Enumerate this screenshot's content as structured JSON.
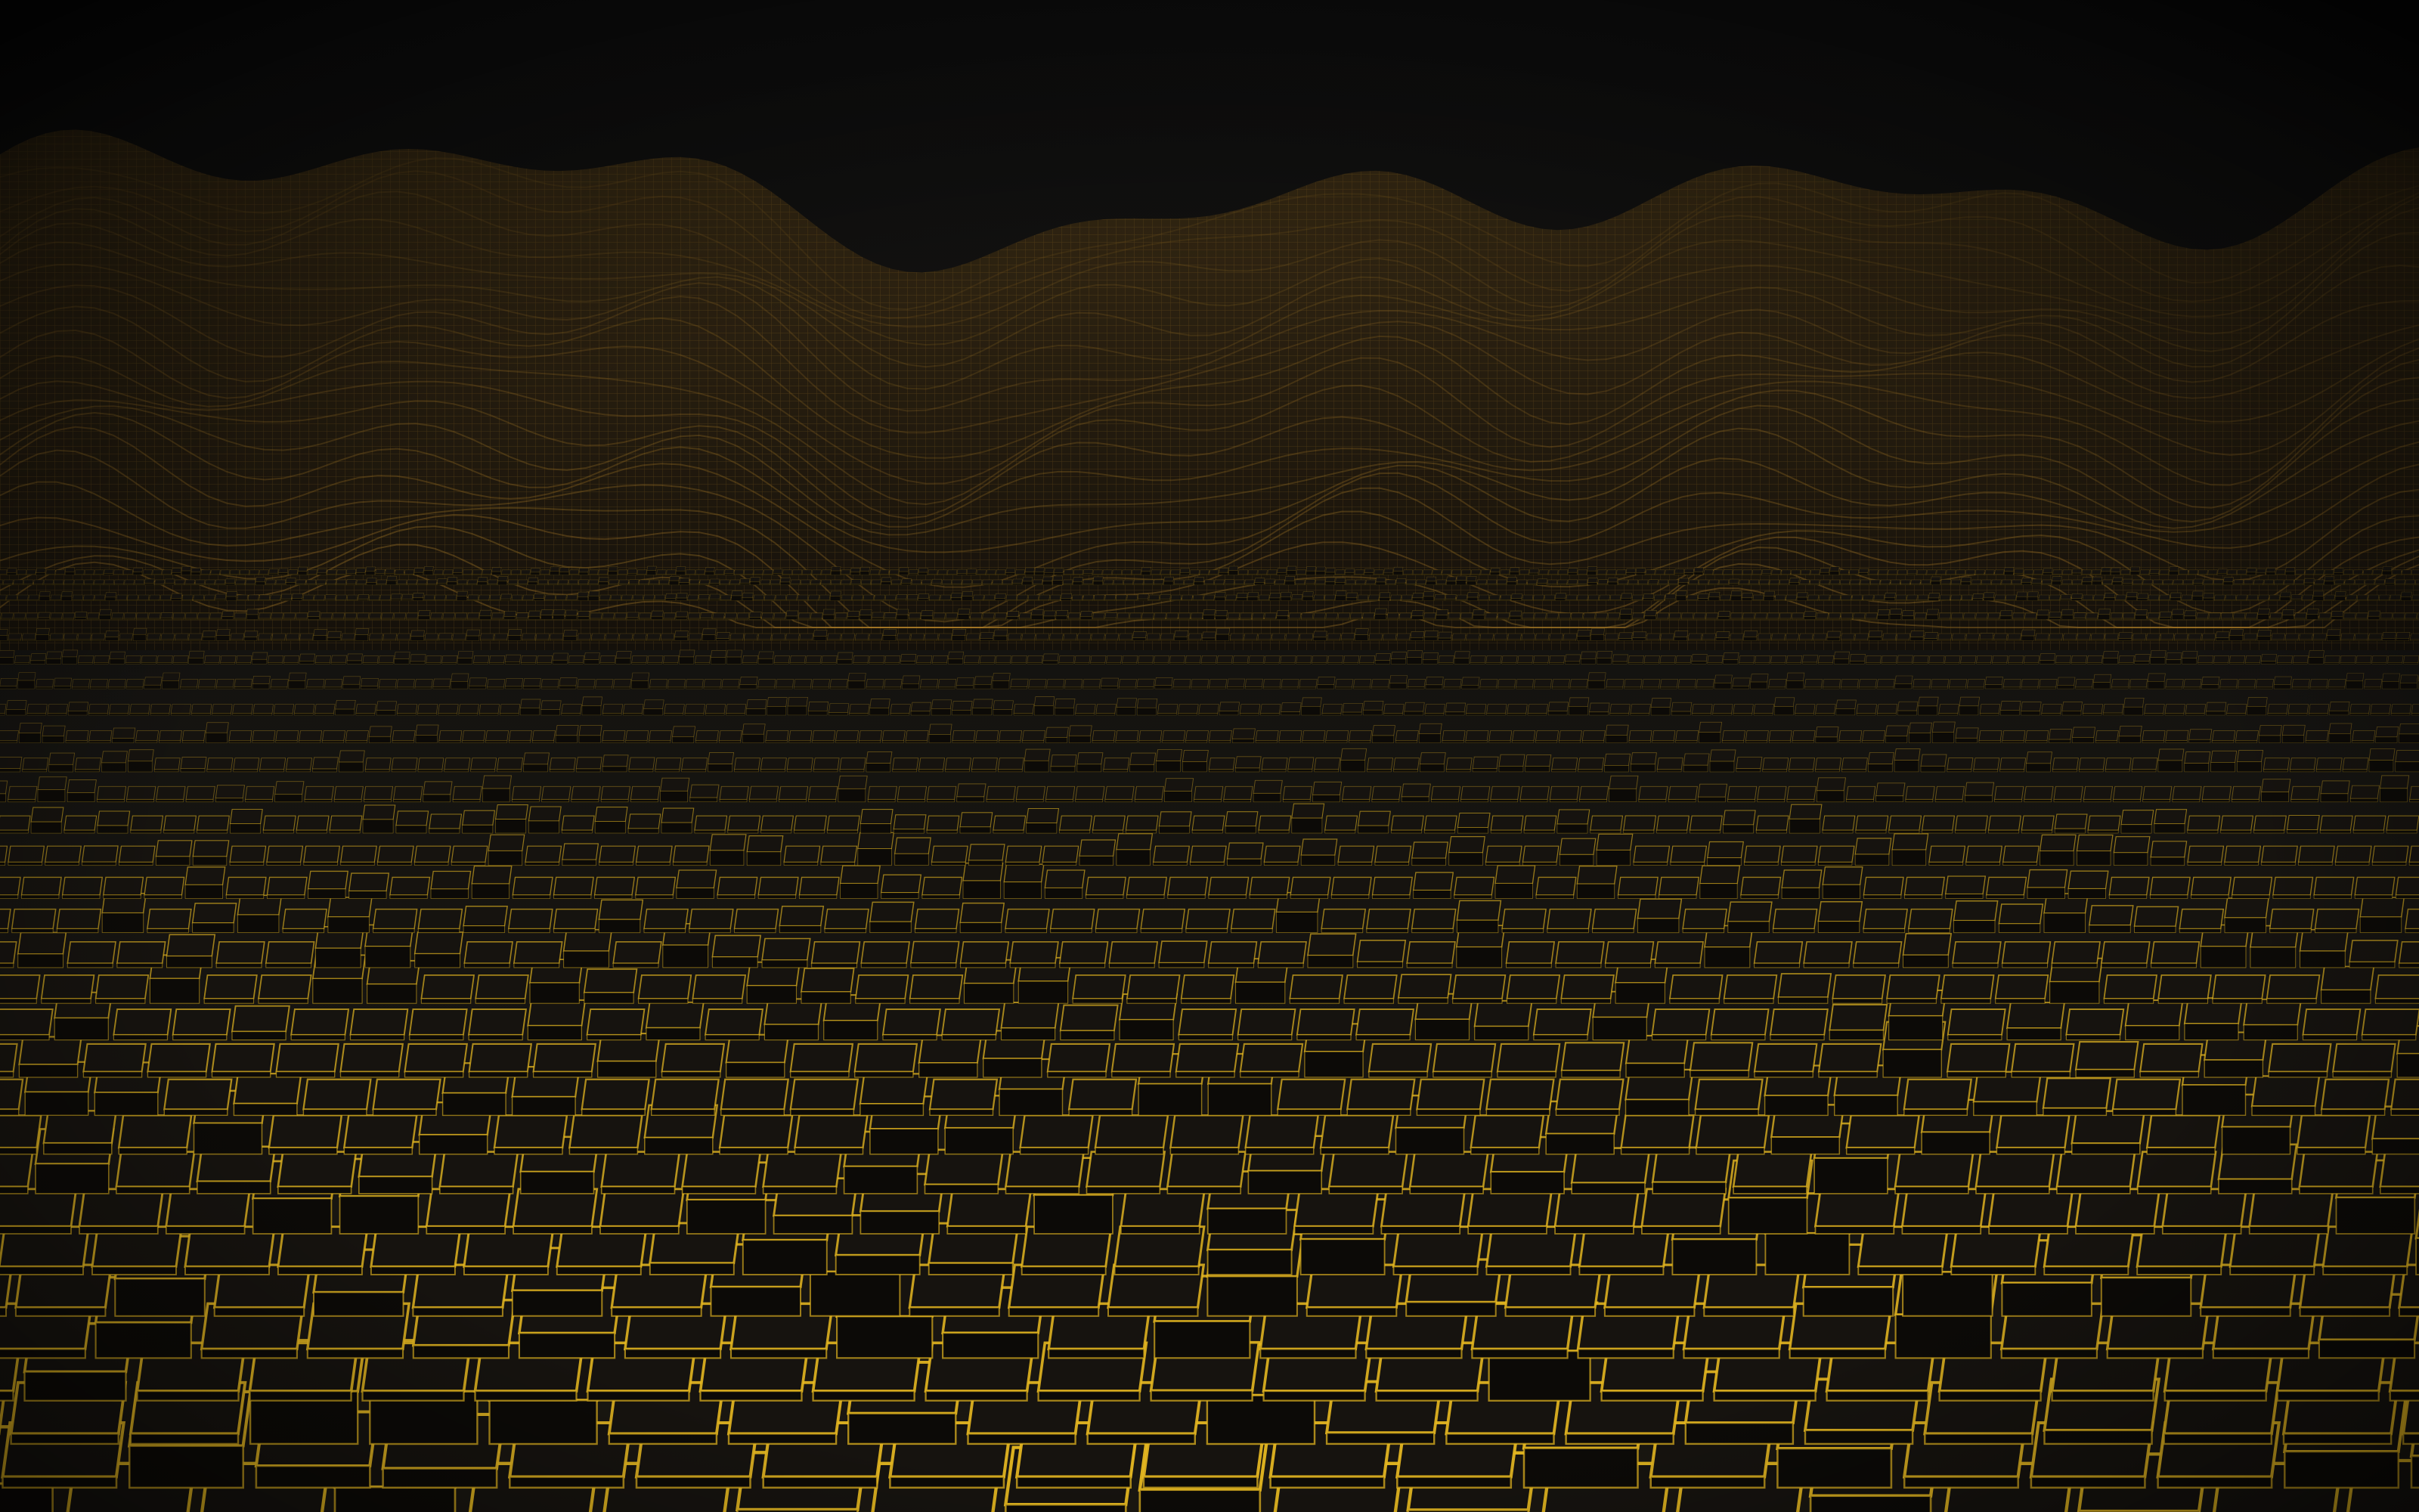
{
  "scene": {
    "description_name": "abstract-3d-gold-grid-landscape",
    "colors": {
      "sky": "#121110",
      "mountain_fill": "#1a150e",
      "mountain_wire": "#b8862a",
      "cube_face": "#16130f",
      "cube_edge": "#e6b821",
      "cube_edge_far": "#a88520"
    }
  }
}
